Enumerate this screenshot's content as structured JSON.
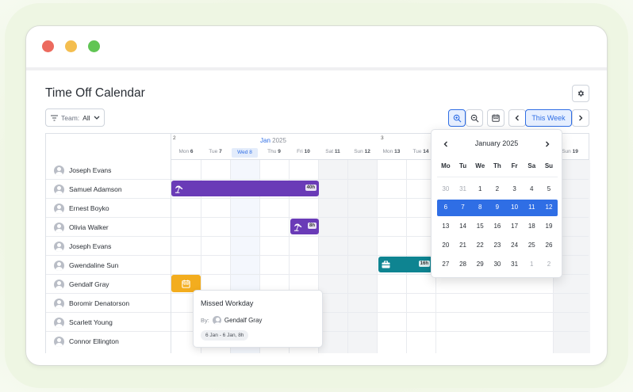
{
  "page": {
    "title": "Time Off Calendar"
  },
  "toolbar": {
    "team_label": "Team:",
    "team_value": "All",
    "this_week_label": "This Week"
  },
  "calendar": {
    "week_numbers": [
      "2",
      "3"
    ],
    "month": "Jan",
    "year": "2025",
    "days": [
      {
        "dow": "Mon",
        "num": "6"
      },
      {
        "dow": "Tue",
        "num": "7"
      },
      {
        "dow": "Wed",
        "num": "8"
      },
      {
        "dow": "Thu",
        "num": "9"
      },
      {
        "dow": "Fri",
        "num": "10"
      },
      {
        "dow": "Sat",
        "num": "11"
      },
      {
        "dow": "Sun",
        "num": "12"
      },
      {
        "dow": "Mon",
        "num": "13"
      },
      {
        "dow": "Tue",
        "num": "14"
      },
      {
        "dow": "Sun",
        "num": "19"
      }
    ],
    "people": [
      "Joseph Evans",
      "Samuel Adamson",
      "Ernest Boyko",
      "Olivia Walker",
      "Joseph Evans",
      "Gwendaline Sun",
      "Gendalf Gray",
      "Boromir Denatorson",
      "Scarlett Young",
      "Connor Ellington"
    ],
    "bars": [
      {
        "label": "40h",
        "color": "#6a3bb7",
        "icon": "beach-icon"
      },
      {
        "label": "8h",
        "color": "#6a3bb7",
        "icon": "beach-icon"
      },
      {
        "label": "16h",
        "color": "#0e8491",
        "icon": "briefcase-icon"
      },
      {
        "label": "",
        "color": "#f3ad1e",
        "icon": "calendar-icon"
      }
    ]
  },
  "popover": {
    "title": "Missed Workday",
    "by_label": "By:",
    "by_name": "Gendalf Gray",
    "range": "6 Jan - 6 Jan, 8h"
  },
  "datepicker": {
    "title": "January 2025",
    "weekdays": [
      "Mo",
      "Tu",
      "We",
      "Th",
      "Fr",
      "Sa",
      "Su"
    ],
    "weeks": [
      [
        "30",
        "31",
        "1",
        "2",
        "3",
        "4",
        "5"
      ],
      [
        "6",
        "7",
        "8",
        "9",
        "10",
        "11",
        "12"
      ],
      [
        "13",
        "14",
        "15",
        "16",
        "17",
        "18",
        "19"
      ],
      [
        "20",
        "21",
        "22",
        "23",
        "24",
        "25",
        "26"
      ],
      [
        "27",
        "28",
        "29",
        "30",
        "31",
        "1",
        "2"
      ]
    ],
    "selected_week_index": 1
  }
}
